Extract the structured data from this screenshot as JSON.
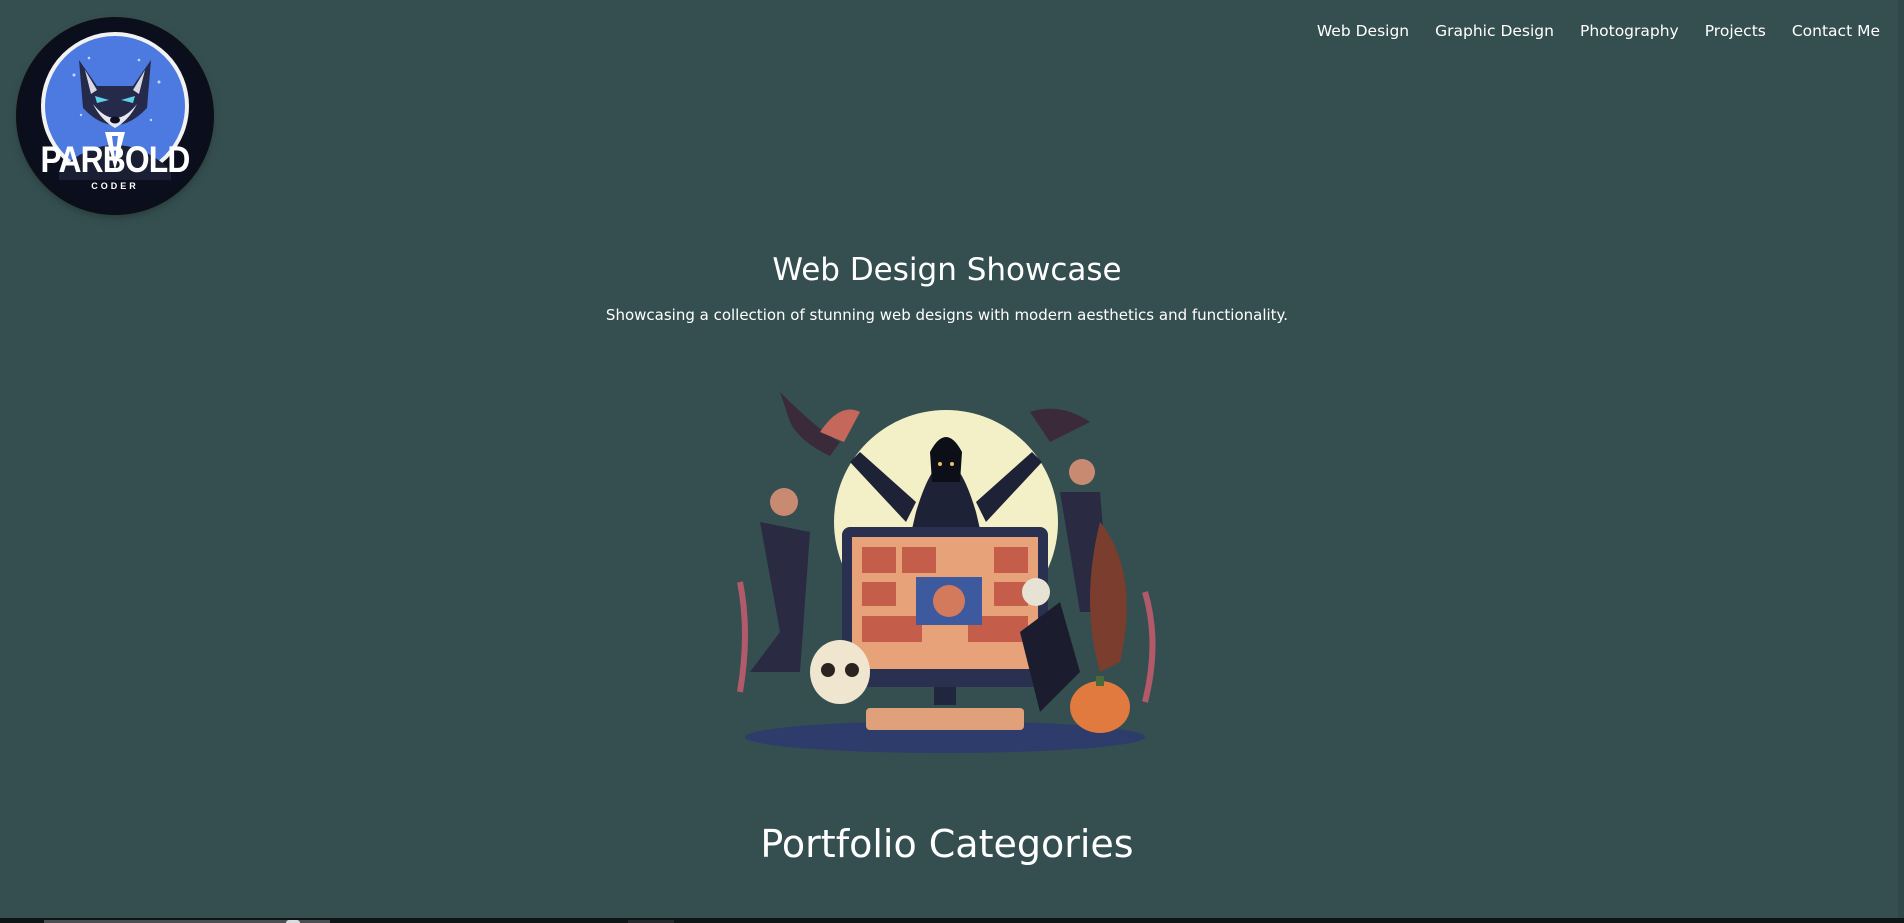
{
  "logo": {
    "title": "PARBOLD",
    "subtitle": "CODER",
    "icon": "fox-mascot-icon"
  },
  "nav": {
    "items": [
      {
        "label": "Web Design"
      },
      {
        "label": "Graphic Design"
      },
      {
        "label": "Photography"
      },
      {
        "label": "Projects"
      },
      {
        "label": "Contact Me"
      }
    ]
  },
  "hero": {
    "title": "Web Design Showcase",
    "subtitle": "Showcasing a collection of stunning web designs with modern aesthetics and functionality.",
    "image_icon": "web-design-illustration"
  },
  "section": {
    "title": "Portfolio Categories"
  },
  "colors": {
    "background": "#354f50",
    "text": "#ffffff",
    "logo_ring": "#4d7ae0"
  }
}
